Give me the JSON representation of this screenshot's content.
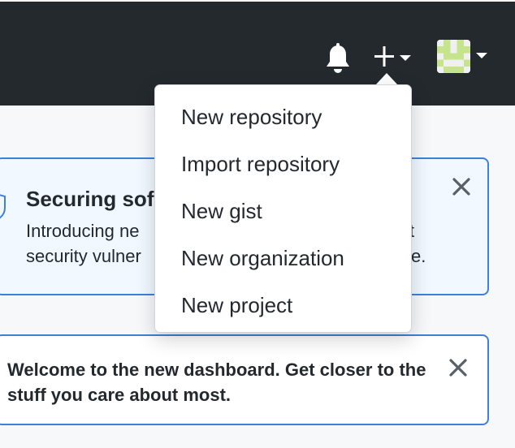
{
  "header": {
    "notifications_icon": "bell-icon",
    "create_icon": "plus-icon",
    "avatar_icon": "identicon-avatar"
  },
  "create_menu": {
    "items": [
      {
        "label": "New repository"
      },
      {
        "label": "Import repository"
      },
      {
        "label": "New gist"
      },
      {
        "label": "New organization"
      },
      {
        "label": "New project"
      }
    ]
  },
  "security_banner": {
    "title": "Securing sof",
    "line1_start": "Introducing ne",
    "line1_end": "t",
    "line2_start": "security vulner",
    "line2_end": "e."
  },
  "dashboard_banner": {
    "text": "Welcome to the new dashboard. Get closer to the stuff you care about most."
  },
  "colors": {
    "header_bg": "#24292e",
    "banner_border": "#3d80d9",
    "avatar_accent": "#c6e48b"
  }
}
